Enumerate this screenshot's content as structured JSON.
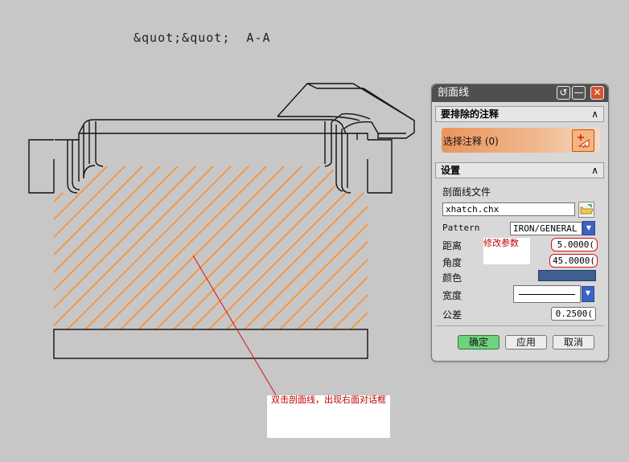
{
  "view": {
    "title": "&quot;&quot;  A-A"
  },
  "notes": {
    "double_click": "双击剖面线，出现右面对话框",
    "modify_params": "修改参数"
  },
  "dialog": {
    "title": "剖面线",
    "title_buttons": {
      "reset": "reset-icon",
      "minimize": "minimize-icon",
      "close": "close-icon"
    },
    "exclude_section": {
      "header": "要排除的注释",
      "select_label": "选择注释 (0)"
    },
    "settings_section": {
      "header": "设置",
      "hatch_file_label": "剖面线文件",
      "hatch_file_value": "xhatch.chx",
      "pattern_label": "Pattern",
      "pattern_value": "IRON/GENERAL U:",
      "distance_label": "距离",
      "distance_value": "5.0000(",
      "angle_label": "角度",
      "angle_value": "45.0000(",
      "color_label": "颜色",
      "color_value": "#3e5f8f",
      "width_label": "宽度",
      "tolerance_label": "公差",
      "tolerance_value": "0.2500("
    },
    "buttons": {
      "ok": "确定",
      "apply": "应用",
      "cancel": "取消"
    }
  },
  "colors": {
    "background": "#c7c7c7",
    "hatch": "#ff8c2a",
    "leader_line": "#d41414",
    "titlebar": "#4f4f4f"
  }
}
